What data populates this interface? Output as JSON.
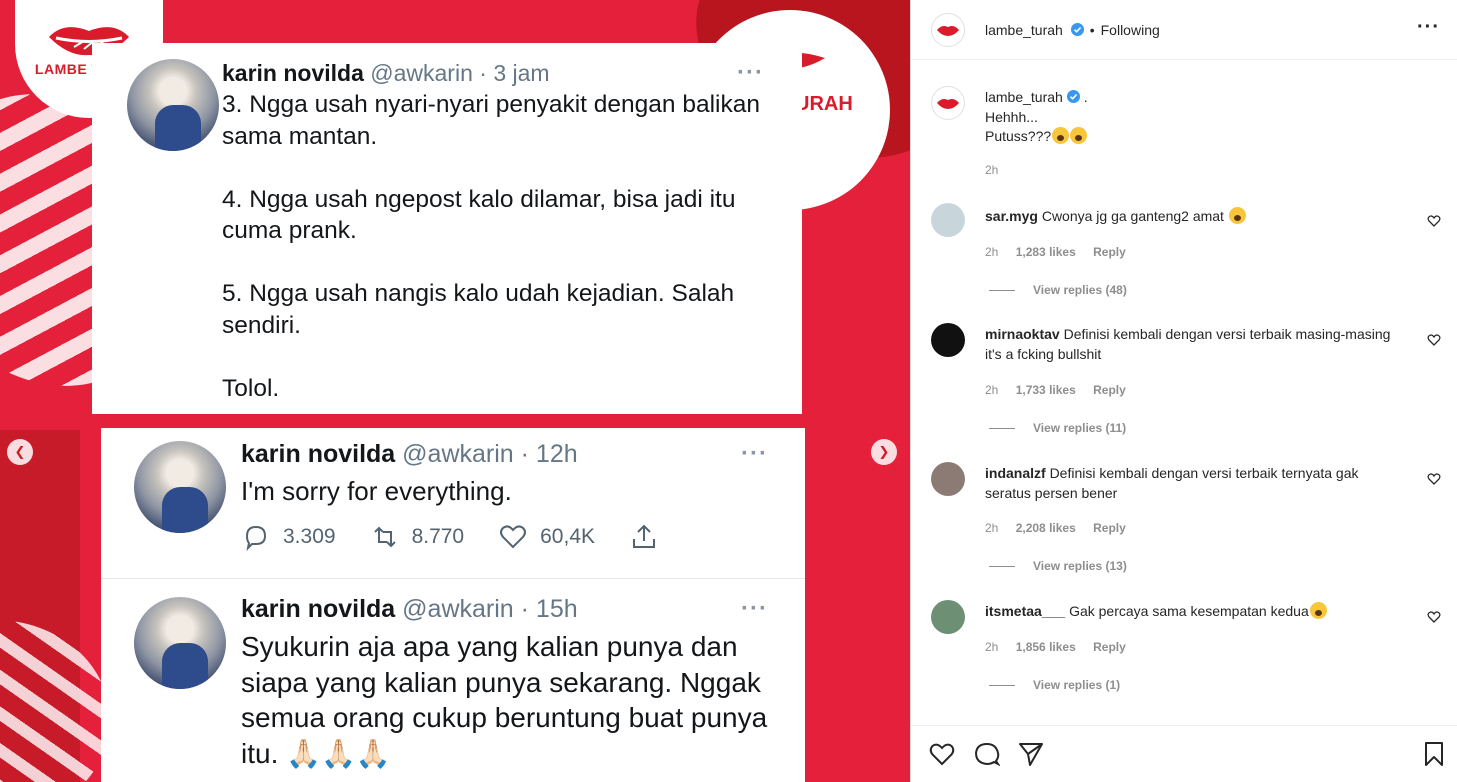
{
  "colors": {
    "brand_red": "#e5203a",
    "verified_blue": "#3897f0",
    "meta_gray": "#8e8e8e"
  },
  "media": {
    "logo_text": "LAMBE TURAH",
    "logo_partial_text": "URAH",
    "nav_prev_icon": "chevron-left-icon",
    "nav_next_icon": "chevron-right-icon",
    "tweets": [
      {
        "name": "karin novilda",
        "handle": "@awkarin",
        "time": "· 3 jam",
        "more": "···",
        "body": "3. Ngga usah nyari-nyari penyakit dengan balikan\nsama mantan.\n\n4. Ngga usah ngepost kalo dilamar, bisa jadi itu\ncuma prank.\n\n5. Ngga usah nangis kalo udah kejadian. Salah\nsendiri.\n\nTolol."
      },
      {
        "name": "karin novilda",
        "handle": "@awkarin",
        "time": "· 12h",
        "more": "···",
        "body": "I'm sorry for everything.",
        "replies": "3.309",
        "retweets": "8.770",
        "likes": "60,4K"
      },
      {
        "name": "karin novilda",
        "handle": "@awkarin",
        "time": "· 15h",
        "more": "···",
        "body": "Syukurin aja apa yang kalian punya dan\nsiapa yang kalian punya sekarang. Nggak\nsemua orang cukup beruntung buat punya\nitu. 🙏🏻🙏🏻🙏🏻"
      }
    ]
  },
  "header": {
    "username": "lambe_turah",
    "separator": "•",
    "follow_status": "Following",
    "more": "···"
  },
  "caption": {
    "username": "lambe_turah",
    "suffix": ".",
    "line1": "Hehhh...",
    "line2": "Putuss???",
    "time": "2h"
  },
  "comments": [
    {
      "user": "sar.myg",
      "text": "Cwonya jg ga ganteng2 amat",
      "time": "2h",
      "likes": "1,283 likes",
      "reply": "Reply",
      "view_replies": "View replies (48)",
      "avatar_color": "#c8d6dc"
    },
    {
      "user": "mirnaoktav",
      "text": "Definisi kembali dengan versi terbaik masing-masing it's a fcking bullshit",
      "time": "2h",
      "likes": "1,733 likes",
      "reply": "Reply",
      "view_replies": "View replies (11)",
      "avatar_color": "#111111"
    },
    {
      "user": "indanalzf",
      "text": "Definisi kembali dengan versi terbaik ternyata gak seratus persen bener",
      "time": "2h",
      "likes": "2,208 likes",
      "reply": "Reply",
      "view_replies": "View replies (13)",
      "avatar_color": "#8b7b74"
    },
    {
      "user": "itsmetaa___",
      "text": "Gak percaya sama kesempatan kedua",
      "time": "2h",
      "likes": "1,856 likes",
      "reply": "Reply",
      "view_replies": "View replies (1)",
      "avatar_color": "#6d8f74"
    }
  ],
  "actions": {
    "like_icon": "heart-icon",
    "comment_icon": "comment-icon",
    "share_icon": "send-icon",
    "save_icon": "bookmark-icon"
  }
}
